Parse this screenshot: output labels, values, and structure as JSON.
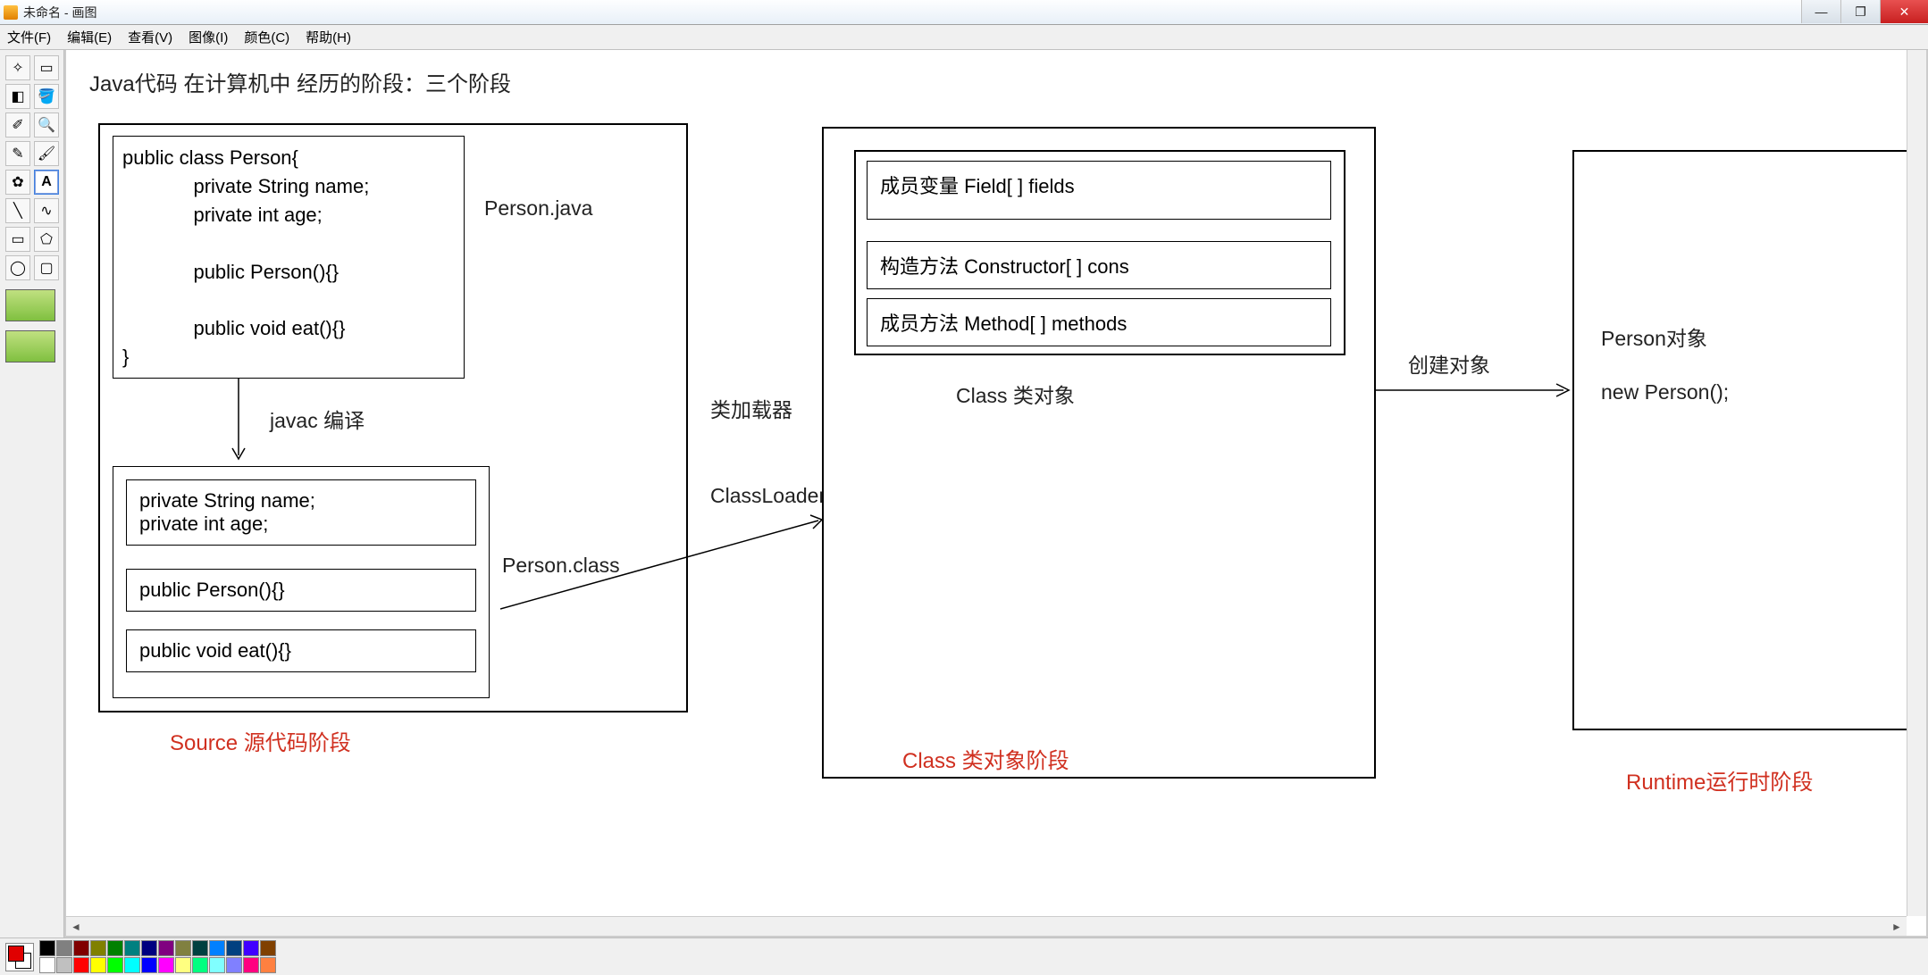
{
  "window": {
    "title": "未命名 - 画图"
  },
  "menu": {
    "file": "文件(F)",
    "edit": "编辑(E)",
    "view": "查看(V)",
    "image": "图像(I)",
    "colors": "颜色(C)",
    "help": "帮助(H)"
  },
  "diagram": {
    "title": "Java代码 在计算机中 经历的阶段：三个阶段",
    "stage1": {
      "code": "public class Person{\n             private String name;\n             private int age;\n\n             public Person(){}\n\n             public void eat(){}\n}",
      "file_java": "Person.java",
      "compile_label": "javac 编译",
      "field1": "private String name;\nprivate int age;",
      "field2": "public Person(){}",
      "field3": "public void eat(){}",
      "file_class": "Person.class",
      "label": "Source 源代码阶段"
    },
    "loader": {
      "l1": "类加载器",
      "l2": "ClassLoader"
    },
    "stage2": {
      "row1": "成员变量  Field[ ] fields",
      "row2": "构造方法  Constructor[ ] cons",
      "row3": "成员方法 Method[ ] methods",
      "class_obj": "Class 类对象",
      "label": "Class 类对象阶段"
    },
    "create": "创建对象",
    "stage3": {
      "l1": "Person对象",
      "l2": "new Person();",
      "label": "Runtime运行时阶段"
    }
  },
  "palette": [
    "#000000",
    "#808080",
    "#800000",
    "#808000",
    "#008000",
    "#008080",
    "#000080",
    "#800080",
    "#808040",
    "#004040",
    "#0080ff",
    "#004080",
    "#4000ff",
    "#804000",
    "#ffffff",
    "#c0c0c0",
    "#ff0000",
    "#ffff00",
    "#00ff00",
    "#00ffff",
    "#0000ff",
    "#ff00ff",
    "#ffff80",
    "#00ff80",
    "#80ffff",
    "#8080ff",
    "#ff0080",
    "#ff8040"
  ]
}
